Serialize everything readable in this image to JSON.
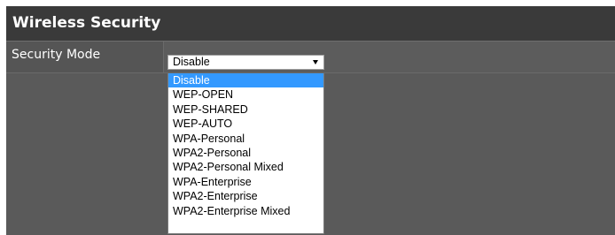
{
  "panel": {
    "title": "Wireless Security"
  },
  "security_mode": {
    "label": "Security Mode",
    "selected_value": "Disable",
    "options": [
      "Disable",
      "WEP-OPEN",
      "WEP-SHARED",
      "WEP-AUTO",
      "WPA-Personal",
      "WPA2-Personal",
      "WPA2-Personal Mixed",
      "WPA-Enterprise",
      "WPA2-Enterprise",
      "WPA2-Enterprise Mixed"
    ],
    "highlighted_option": "Disable"
  },
  "icons": {
    "dropdown_arrow": "chevron-down-icon"
  },
  "colors": {
    "highlight": "#3399ff",
    "panel_background": "#5a5a5a",
    "header_background": "#3a3a3a"
  }
}
